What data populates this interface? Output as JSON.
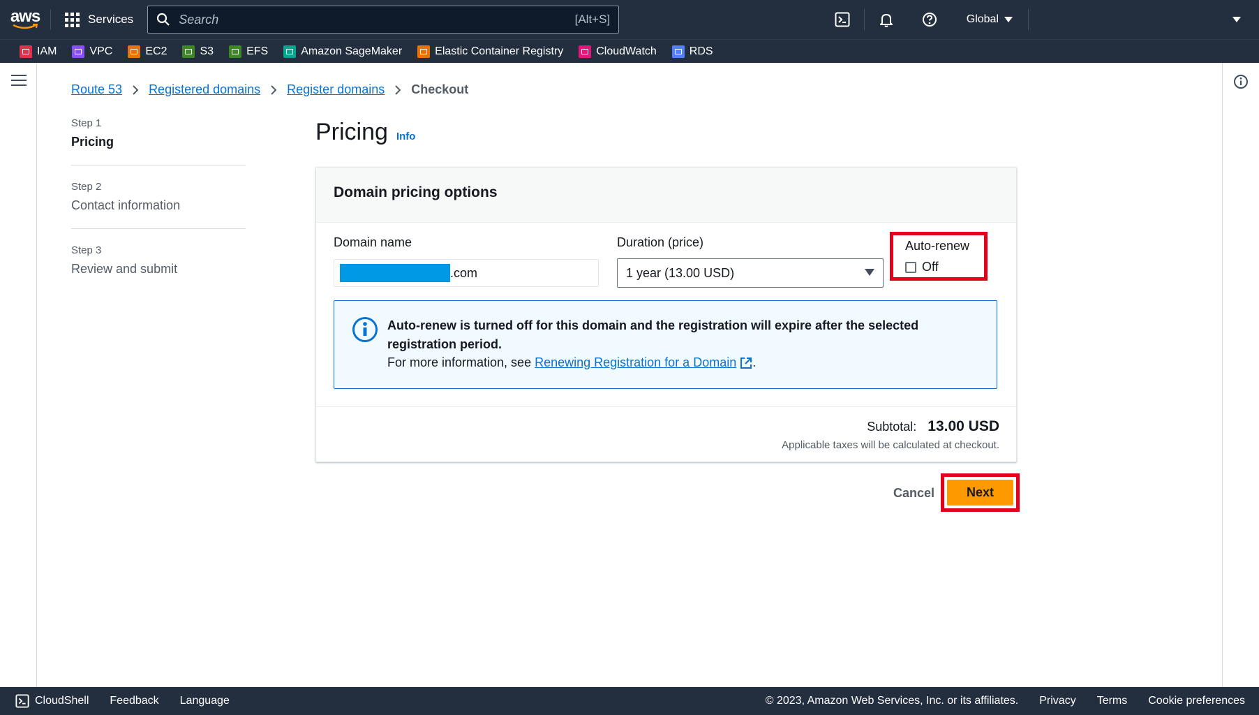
{
  "topnav": {
    "logo": "aws",
    "services_label": "Services",
    "search_placeholder": "Search",
    "search_shortcut": "[Alt+S]",
    "region": "Global"
  },
  "favorites": [
    {
      "label": "IAM",
      "color": "#dd344c"
    },
    {
      "label": "VPC",
      "color": "#8c4fff"
    },
    {
      "label": "EC2",
      "color": "#ed7100"
    },
    {
      "label": "S3",
      "color": "#3f8624"
    },
    {
      "label": "EFS",
      "color": "#3f8624"
    },
    {
      "label": "Amazon SageMaker",
      "color": "#01a88d"
    },
    {
      "label": "Elastic Container Registry",
      "color": "#ed7100"
    },
    {
      "label": "CloudWatch",
      "color": "#e7157b"
    },
    {
      "label": "RDS",
      "color": "#527fff"
    }
  ],
  "breadcrumbs": [
    "Route 53",
    "Registered domains",
    "Register domains",
    "Checkout"
  ],
  "steps": [
    {
      "num": "Step 1",
      "label": "Pricing"
    },
    {
      "num": "Step 2",
      "label": "Contact information"
    },
    {
      "num": "Step 3",
      "label": "Review and submit"
    }
  ],
  "page": {
    "title": "Pricing",
    "info": "Info"
  },
  "card": {
    "header": "Domain pricing options",
    "domain_label": "Domain name",
    "domain_suffix": ".com",
    "duration_label": "Duration (price)",
    "duration_value": "1 year (13.00 USD)",
    "autorenew_label": "Auto-renew",
    "autorenew_state": "Off",
    "alert_bold": "Auto-renew is turned off for this domain and the registration will expire after the selected registration period.",
    "alert_text": "For more information, see",
    "alert_link": "Renewing Registration for a Domain",
    "alert_end": ".",
    "subtotal_label": "Subtotal:",
    "subtotal_value": "13.00 USD",
    "tax_note": "Applicable taxes will be calculated at checkout."
  },
  "actions": {
    "cancel": "Cancel",
    "next": "Next"
  },
  "footer": {
    "cloudshell": "CloudShell",
    "feedback": "Feedback",
    "language": "Language",
    "copyright": "© 2023, Amazon Web Services, Inc. or its affiliates.",
    "privacy": "Privacy",
    "terms": "Terms",
    "cookies": "Cookie preferences"
  },
  "colors": {
    "nav_bg": "#232f3e",
    "link": "#0972d3",
    "primary_button": "#ff9900",
    "highlight": "#e3001b"
  }
}
